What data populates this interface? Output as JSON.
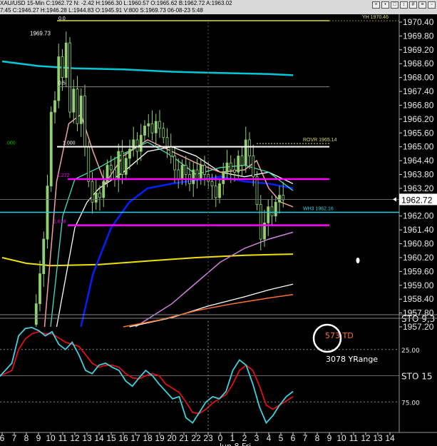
{
  "header": {
    "line1": "XAU/USD 15-Min  C:1962.72  N: -2.42  H:1966.30  L:1960.57  O:1965.62  B:1962.72  A:1963.02",
    "line2": "7:45  C:1946.27  H:1946.28  L:1944.83  O:1945.91  V:800  S:1969.73  06-08-23  5:48",
    "icons": [
      "close-icon",
      "dot-icon",
      "square-icon",
      "arrow-icon",
      "grid-icon",
      "list-icon",
      "box-icon"
    ]
  },
  "chart_data": {
    "type": "line",
    "price_axis": {
      "ticks": [
        "1970.40",
        "1969.80",
        "1969.20",
        "1968.60",
        "1968.00",
        "1967.40",
        "1966.80",
        "1966.20",
        "1965.60",
        "1965.00",
        "1964.40",
        "1963.80",
        "1963.20",
        "1962.60",
        "1962.00",
        "1961.40",
        "1960.80",
        "1960.20",
        "1959.60",
        "1959.00",
        "1958.40",
        "1957.80",
        "1957.20"
      ],
      "ylim": [
        1956.9,
        1970.6
      ],
      "current_price": "1962.72"
    },
    "time_axis": {
      "ticks": [
        "6",
        "7",
        "8",
        "9",
        "10",
        "11",
        "12",
        "13",
        "14",
        "15",
        "16",
        "17",
        "18",
        "19",
        "20",
        "21",
        "22",
        "23",
        "0",
        "1",
        "2",
        "3",
        "4",
        "5",
        "6",
        "7",
        "8",
        "9",
        "10",
        "11",
        "12",
        "13",
        "14"
      ],
      "date_label": "Jun 8 Fri"
    },
    "levels": [
      {
        "label": "YH 1970.46",
        "price": 1970.46,
        "color": "#d8d860"
      },
      {
        "label": "ROVR 1965.14",
        "price": 1965.14,
        "color": "#d8d860"
      },
      {
        "label": "WH3 1962.16",
        "price": 1962.16,
        "color": "#30d0e0"
      },
      {
        "label": "1.000",
        "price": 1965.0,
        "color": "#ffffff"
      },
      {
        "label": "1.272",
        "price": 1963.6,
        "color": "#ff00ff"
      },
      {
        "label": "1.618",
        "price": 1961.6,
        "color": "#ff00ff"
      },
      {
        "label": "1969.73",
        "price": 1969.73,
        "color": "#ffffff"
      },
      {
        "label": ".000",
        "price": 1965.0,
        "color": "#00c000"
      },
      {
        "label": "0.0",
        "price": 1970.4,
        "color": "#ffffff"
      },
      {
        "label": "0.5",
        "price": 1967.6,
        "color": "#ffffff"
      }
    ],
    "stochastic": {
      "label": "STO  15",
      "top_label": "STO  9,3",
      "levels": [
        "25.00",
        "75.00"
      ],
      "k": [
        48,
        55,
        62,
        88,
        95,
        96,
        93,
        88,
        92,
        80,
        75,
        82,
        70,
        55,
        52,
        60,
        62,
        58,
        55,
        45,
        40,
        48,
        55,
        50,
        42,
        35,
        28,
        30,
        10,
        5,
        15,
        25,
        30,
        28,
        35,
        55,
        65,
        60,
        42,
        20,
        5,
        12,
        22,
        30,
        35
      ],
      "d": [
        50,
        52,
        55,
        75,
        85,
        90,
        92,
        90,
        90,
        86,
        82,
        80,
        78,
        70,
        62,
        58,
        60,
        60,
        58,
        52,
        48,
        47,
        50,
        52,
        50,
        42,
        38,
        34,
        25,
        15,
        14,
        18,
        24,
        28,
        32,
        42,
        55,
        60,
        55,
        40,
        22,
        18,
        22,
        26,
        30
      ]
    },
    "annotations": {
      "td": "573 TD",
      "yrange": "3078 YRange"
    }
  }
}
